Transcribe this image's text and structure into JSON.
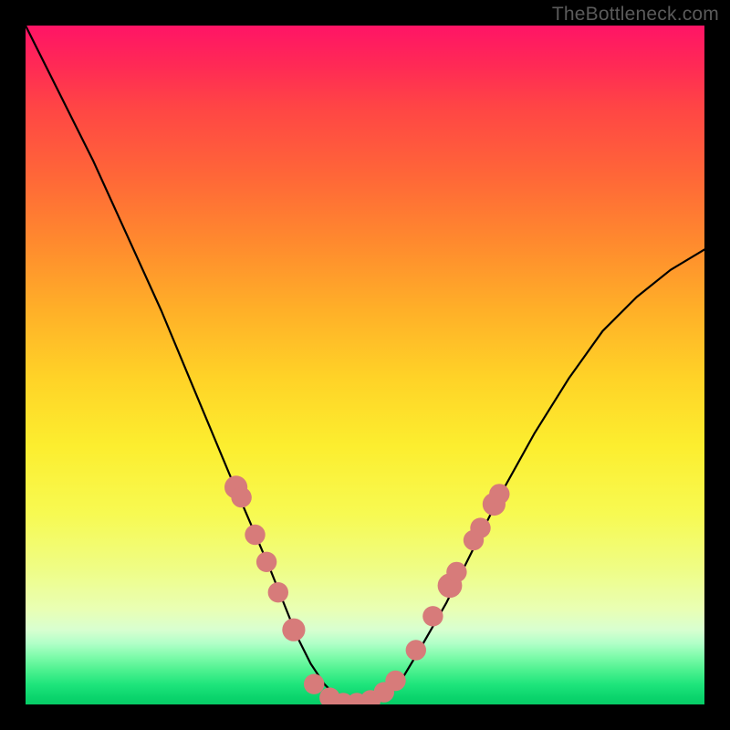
{
  "watermark": "TheBottleneck.com",
  "chart_data": {
    "type": "line",
    "title": "",
    "xlabel": "",
    "ylabel": "",
    "xlim": [
      0,
      100
    ],
    "ylim": [
      0,
      100
    ],
    "grid": false,
    "legend": false,
    "series": [
      {
        "name": "bottleneck-curve",
        "x": [
          0,
          5,
          10,
          15,
          20,
          25,
          30,
          33,
          36,
          38,
          40,
          42,
          44,
          46,
          48,
          50,
          52,
          55,
          58,
          62,
          66,
          70,
          75,
          80,
          85,
          90,
          95,
          100
        ],
        "y": [
          100,
          90,
          80,
          69,
          58,
          46,
          34,
          27,
          20,
          15,
          10,
          6,
          3,
          1,
          0,
          0,
          1,
          3,
          8,
          15,
          23,
          31,
          40,
          48,
          55,
          60,
          64,
          67
        ]
      }
    ],
    "markers": [
      {
        "group": "left-cluster",
        "x": 31.0,
        "y": 32.0,
        "r": 1.7
      },
      {
        "group": "left-cluster",
        "x": 31.8,
        "y": 30.5,
        "r": 1.5
      },
      {
        "group": "left-cluster",
        "x": 33.8,
        "y": 25.0,
        "r": 1.5
      },
      {
        "group": "left-cluster",
        "x": 35.5,
        "y": 21.0,
        "r": 1.5
      },
      {
        "group": "left-cluster",
        "x": 37.2,
        "y": 16.5,
        "r": 1.5
      },
      {
        "group": "left-cluster",
        "x": 39.5,
        "y": 11.0,
        "r": 1.7
      },
      {
        "group": "trough",
        "x": 42.5,
        "y": 3.0,
        "r": 1.5
      },
      {
        "group": "trough",
        "x": 44.8,
        "y": 1.0,
        "r": 1.5
      },
      {
        "group": "trough",
        "x": 46.8,
        "y": 0.2,
        "r": 1.5
      },
      {
        "group": "trough",
        "x": 48.8,
        "y": 0.2,
        "r": 1.5
      },
      {
        "group": "trough",
        "x": 50.8,
        "y": 0.6,
        "r": 1.5
      },
      {
        "group": "trough",
        "x": 52.8,
        "y": 1.8,
        "r": 1.5
      },
      {
        "group": "trough",
        "x": 54.5,
        "y": 3.5,
        "r": 1.5
      },
      {
        "group": "right-cluster",
        "x": 57.5,
        "y": 8.0,
        "r": 1.5
      },
      {
        "group": "right-cluster",
        "x": 60.0,
        "y": 13.0,
        "r": 1.5
      },
      {
        "group": "right-cluster",
        "x": 62.5,
        "y": 17.5,
        "r": 1.8
      },
      {
        "group": "right-cluster",
        "x": 63.5,
        "y": 19.5,
        "r": 1.5
      },
      {
        "group": "right-cluster",
        "x": 66.0,
        "y": 24.2,
        "r": 1.5
      },
      {
        "group": "right-cluster",
        "x": 67.0,
        "y": 26.0,
        "r": 1.5
      },
      {
        "group": "right-cluster",
        "x": 69.0,
        "y": 29.5,
        "r": 1.7
      },
      {
        "group": "right-cluster",
        "x": 69.8,
        "y": 31.0,
        "r": 1.5
      }
    ],
    "marker_color": "#d77b7a",
    "curve_color": "#000000"
  }
}
